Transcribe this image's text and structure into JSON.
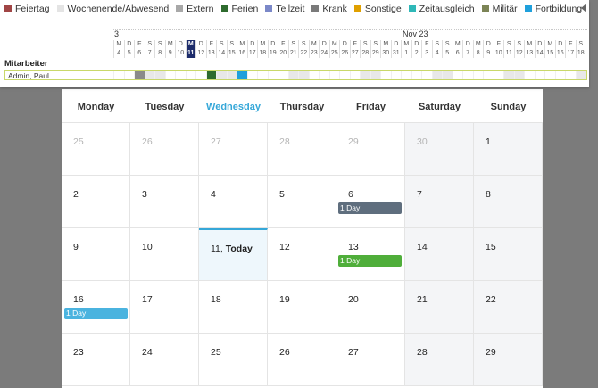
{
  "legend": [
    {
      "label": "Feiertag",
      "color": "#a04545"
    },
    {
      "label": "Wochenende/Abwesend",
      "color": "#e4e4e4"
    },
    {
      "label": "Extern",
      "color": "#a8a8a8"
    },
    {
      "label": "Ferien",
      "color": "#2e6b2e"
    },
    {
      "label": "Teilzeit",
      "color": "#7b88c8"
    },
    {
      "label": "Krank",
      "color": "#7a7a7a"
    },
    {
      "label": "Sonstige",
      "color": "#e0a000"
    },
    {
      "label": "Zeitausgleich",
      "color": "#2fb8b8"
    },
    {
      "label": "Militär",
      "color": "#7c8456"
    },
    {
      "label": "Fortbildung",
      "color": "#1fa0dc"
    }
  ],
  "timeline": {
    "month_first": "3",
    "month_second": "Nov 23",
    "day_letters": [
      "M",
      "D",
      "F",
      "S",
      "S",
      "M",
      "D",
      "M",
      "D",
      "F",
      "S",
      "S",
      "M",
      "D",
      "M",
      "D",
      "F",
      "S",
      "S",
      "M",
      "D",
      "M",
      "D",
      "F",
      "S",
      "S",
      "M",
      "D",
      "M",
      "D",
      "F",
      "S",
      "S",
      "M",
      "D",
      "M",
      "D",
      "F",
      "S",
      "S",
      "M",
      "D",
      "M",
      "D",
      "F",
      "S",
      "S"
    ],
    "day_numbers": [
      "4",
      "5",
      "6",
      "7",
      "8",
      "9",
      "10",
      "11",
      "12",
      "13",
      "14",
      "15",
      "16",
      "17",
      "18",
      "19",
      "20",
      "21",
      "22",
      "23",
      "24",
      "25",
      "26",
      "27",
      "28",
      "29",
      "30",
      "31",
      "1",
      "2",
      "3",
      "4",
      "5",
      "6",
      "7",
      "8",
      "9",
      "10",
      "11",
      "12",
      "13",
      "14",
      "15",
      "16",
      "17",
      "18"
    ],
    "today_index": 7,
    "employee_header": "Mitarbeiter",
    "employee_name": "Admin, Paul",
    "cell_states": [
      "n",
      "n",
      "n",
      "w",
      "w",
      "n",
      "n",
      "n",
      "n",
      "n",
      "w",
      "w",
      "n",
      "n",
      "n",
      "n",
      "n",
      "w",
      "w",
      "n",
      "n",
      "n",
      "n",
      "n",
      "w",
      "w",
      "n",
      "n",
      "n",
      "n",
      "n",
      "w",
      "w",
      "n",
      "n",
      "n",
      "n",
      "n",
      "w",
      "w",
      "n",
      "n",
      "n",
      "n",
      "n",
      "w"
    ],
    "marks": [
      {
        "index": 2,
        "kind": "krank"
      },
      {
        "index": 9,
        "kind": "abs"
      },
      {
        "index": 12,
        "kind": "fort"
      }
    ]
  },
  "calendar": {
    "headers": [
      "Monday",
      "Tuesday",
      "Wednesday",
      "Thursday",
      "Friday",
      "Saturday",
      "Sunday"
    ],
    "active_header": "Wednesday",
    "weeks": [
      [
        "25",
        "26",
        "27",
        "28",
        "29",
        "30",
        "1"
      ],
      [
        "2",
        "3",
        "4",
        "5",
        "6",
        "7",
        "8"
      ],
      [
        "9",
        "10",
        "11, Today",
        "12",
        "13",
        "14",
        "15"
      ],
      [
        "16",
        "17",
        "18",
        "19",
        "20",
        "21",
        "22"
      ],
      [
        "23",
        "24",
        "25",
        "26",
        "27",
        "28",
        "29"
      ]
    ],
    "events": [
      {
        "week": 1,
        "day": 4,
        "label": "1 Day",
        "color": "#5f6e7e"
      },
      {
        "week": 2,
        "day": 4,
        "label": "1 Day",
        "color": "#4fae3a"
      },
      {
        "week": 3,
        "day": 0,
        "label": "1 Day",
        "color": "#4ab3df"
      }
    ]
  }
}
